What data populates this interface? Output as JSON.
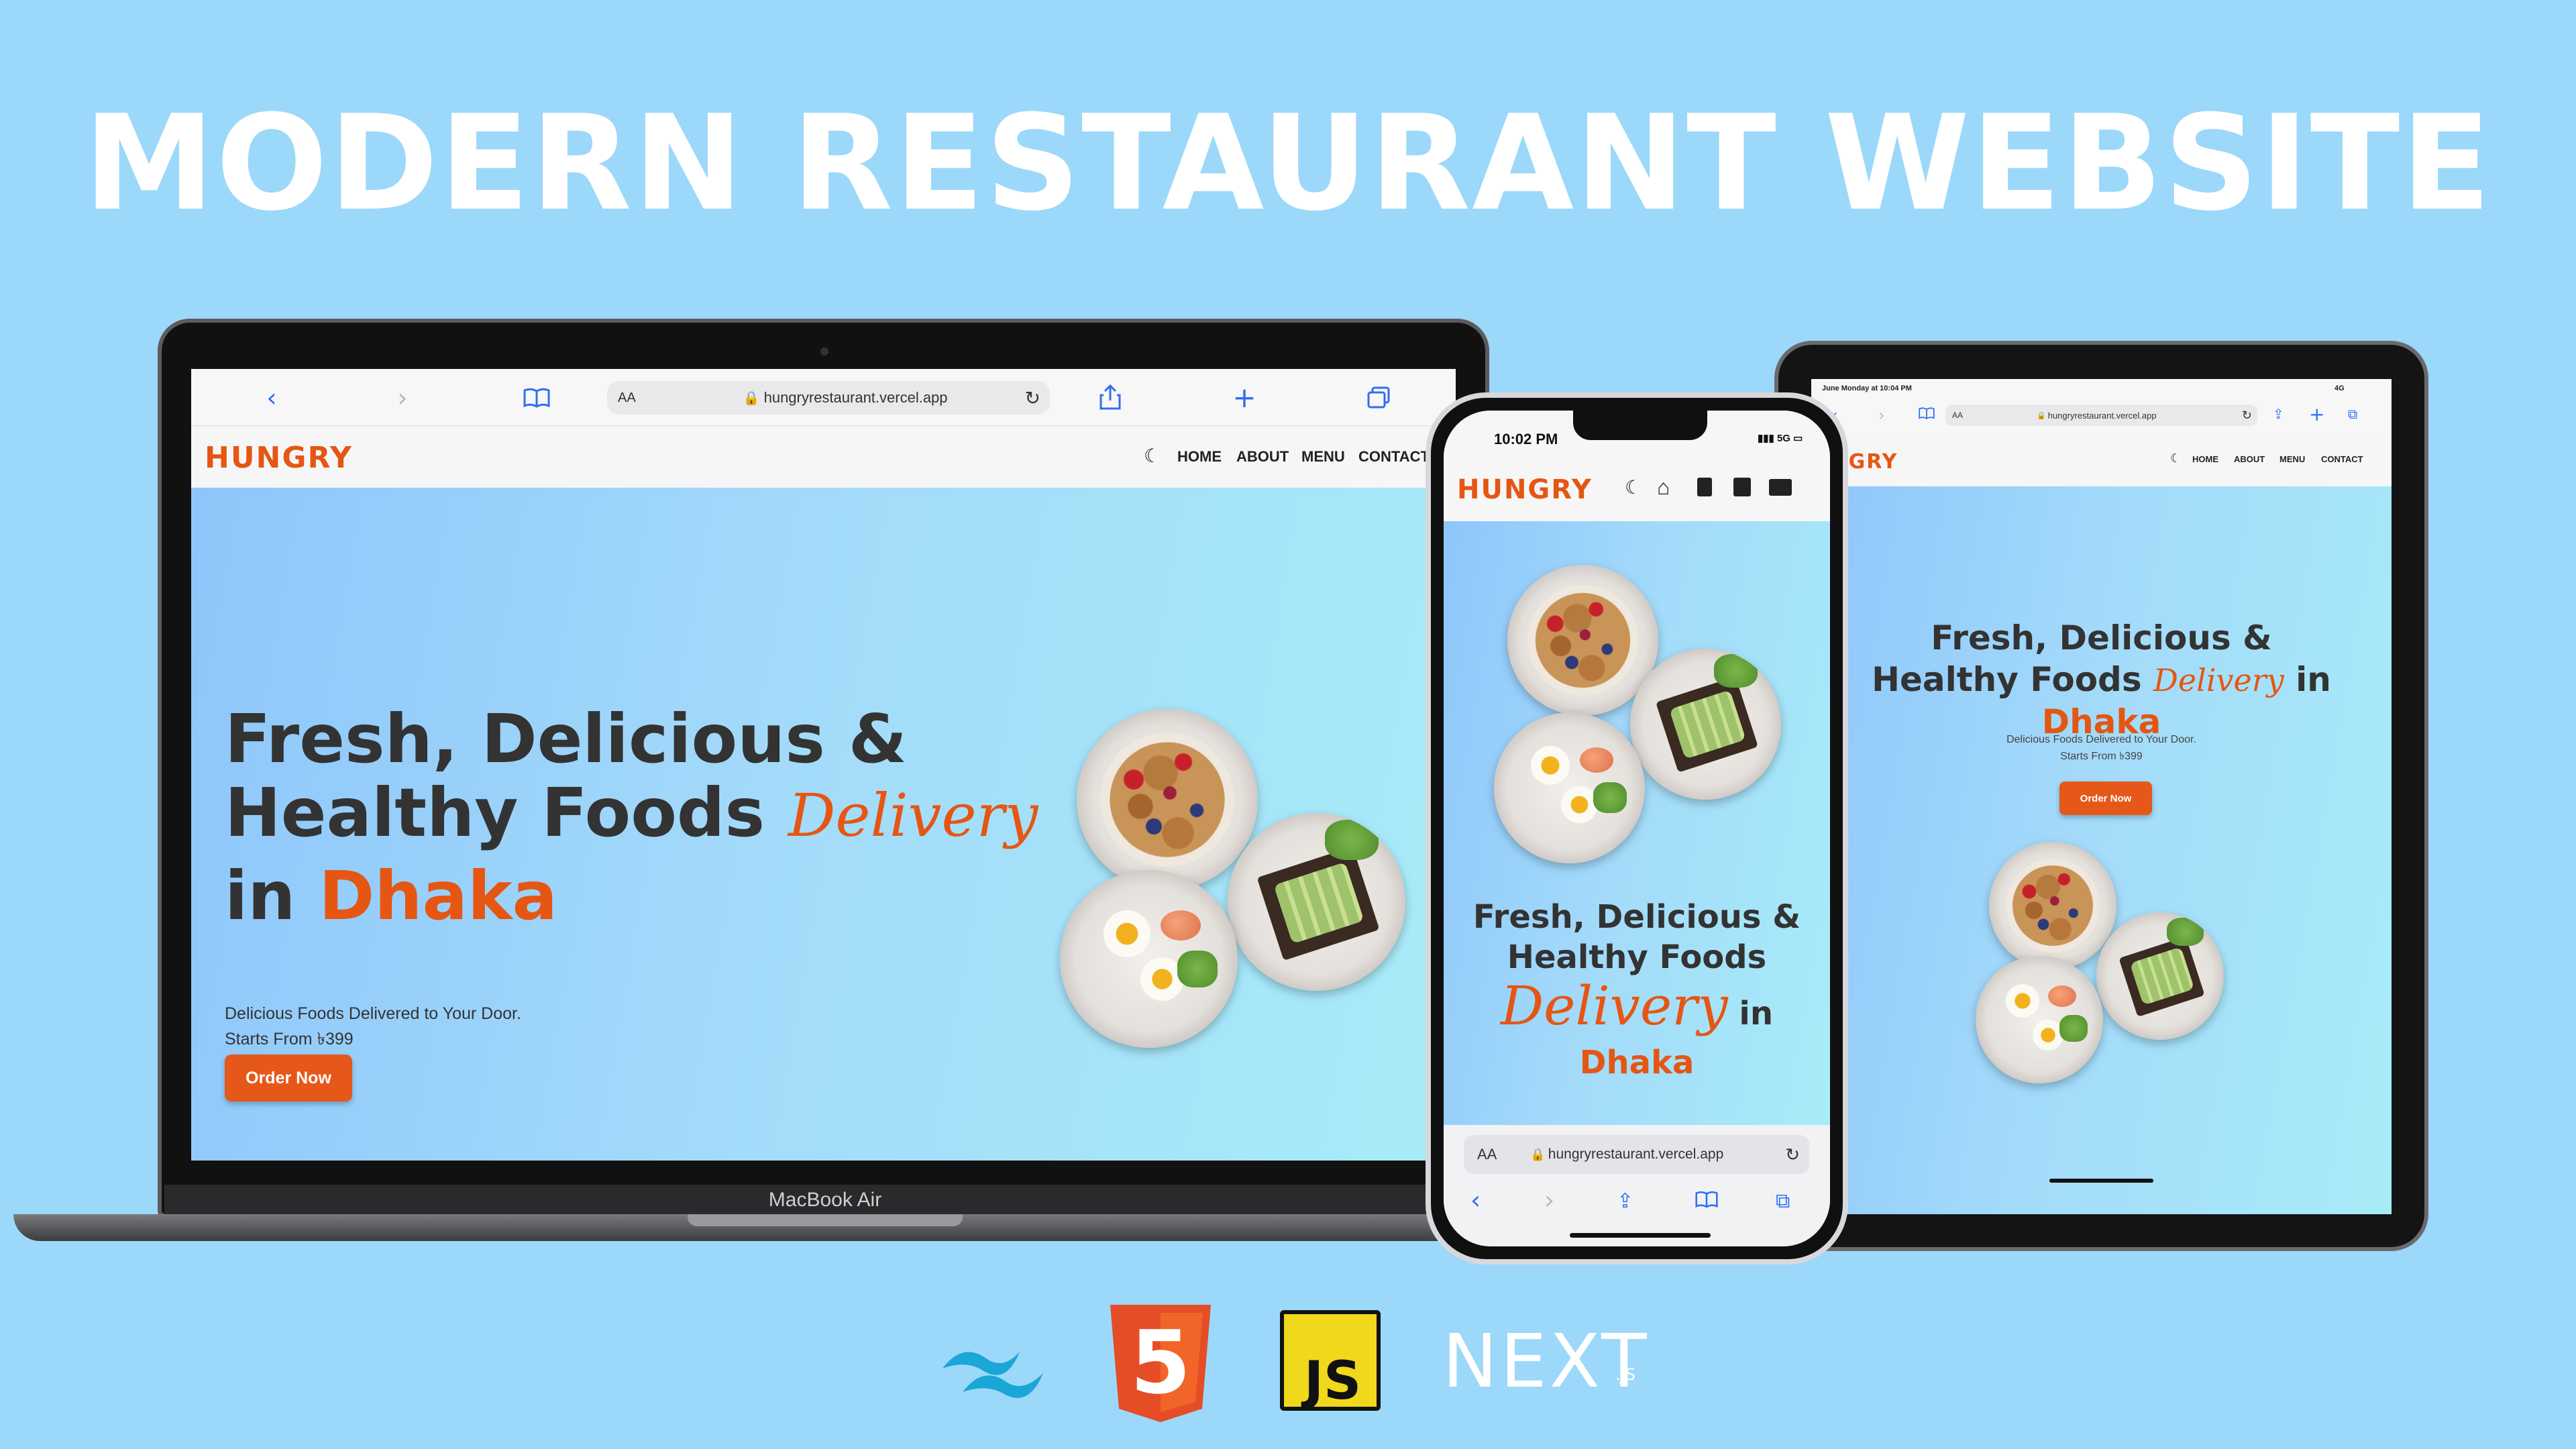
{
  "title": "MODERN RESTAURANT WEBSITE",
  "brand": "HUNGRY",
  "url": "hungryrestaurant.vercel.app",
  "aa_label": "AA",
  "phone_aa_label": "AA",
  "nav": [
    "HOME",
    "ABOUT",
    "MENU",
    "CONTACT"
  ],
  "hero": {
    "line1": "Fresh, Delicious &",
    "line2": "Healthy Foods",
    "script": "Delivery",
    "in": "in",
    "city": "Dhaka",
    "sub1": "Delicious Foods Delivered to Your Door.",
    "sub2": "Starts From ৳399",
    "cta": "Order Now"
  },
  "laptop_label": "MacBook Air",
  "phone_time": "10:02 PM",
  "phone_signal": "5G",
  "tablet_status": "June Monday at 10:04 PM",
  "tablet_signal": "4G",
  "tech": {
    "next_text": "NEXT",
    "next_suffix": ".JS",
    "html_digit": "5",
    "js_text": "JS"
  },
  "colors": {
    "background": "#9cd8f9",
    "accent": "#e55613",
    "heading": "#333333"
  },
  "icons": [
    "back-icon",
    "forward-icon",
    "bookmarks-icon",
    "lock-icon",
    "reload-icon",
    "share-icon",
    "add-tab-icon",
    "tabs-icon",
    "moon-icon",
    "home-icon",
    "about-icon",
    "menu-icon",
    "contact-icon",
    "tailwind-logo",
    "html5-logo",
    "js-logo",
    "nextjs-logo"
  ]
}
